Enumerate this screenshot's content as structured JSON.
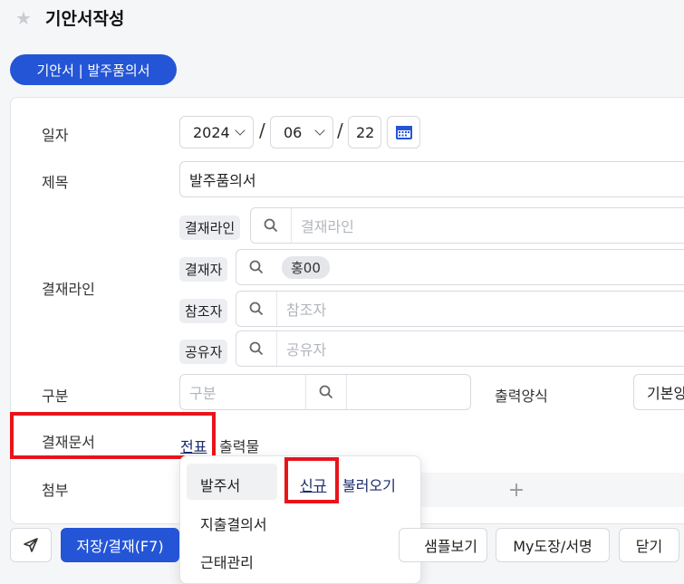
{
  "header": {
    "title": "기안서작성"
  },
  "doc_chip": "기안서 | 발주품의서",
  "form": {
    "date": {
      "label": "일자",
      "year": "2024",
      "month": "06",
      "day": "22",
      "sep1": "/",
      "sep2": "/"
    },
    "subject": {
      "label": "제목",
      "value": "발주품의서"
    },
    "approval": {
      "label": "결재라인",
      "rows": [
        {
          "tag": "결재라인",
          "placeholder": "결재라인"
        },
        {
          "tag": "결재자",
          "chip": "홍00"
        },
        {
          "tag": "참조자",
          "placeholder": "참조자"
        },
        {
          "tag": "공유자",
          "placeholder": "공유자"
        }
      ]
    },
    "category": {
      "label": "구분",
      "placeholder": "구분"
    },
    "output_format": {
      "label": "출력양식",
      "value": "기본양"
    },
    "document": {
      "label": "결재문서",
      "link1": "전표",
      "link2": "출력물"
    },
    "attachment": {
      "label": "첨부",
      "plus": "+"
    }
  },
  "dropdown": {
    "items": [
      {
        "label": "발주서",
        "action_new": "신규",
        "action_load": "불러오기"
      },
      {
        "label": "지출결의서"
      },
      {
        "label": "근태관리"
      }
    ]
  },
  "footer": {
    "save": "저장/결재(F7)",
    "sample": "샘플보기",
    "seal": "My도장/서명",
    "close": "닫기"
  },
  "colors": {
    "accent": "#2455d6",
    "highlight": "#e8141b"
  }
}
